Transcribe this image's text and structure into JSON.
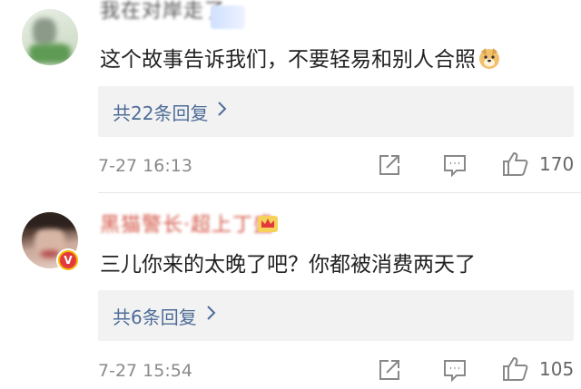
{
  "comments": [
    {
      "username": "我在对岸走了",
      "text": "这个故事告诉我们，不要轻易和别人合照",
      "emoji": "doge-icon",
      "reply_label": "共22条回复",
      "time": "7-27 16:13",
      "likes": "170"
    },
    {
      "username": "黑猫警长·超上丁盛",
      "text": "三儿你来的太晚了吧？你都被消费两天了",
      "verified_badge": "V",
      "reply_label": "共6条回复",
      "time": "7-27 15:54",
      "likes": "105"
    }
  ],
  "colors": {
    "reply_link": "#4d6c98",
    "reply_bg": "#f2f2f2",
    "meta_text": "#8a8a8a",
    "username_red": "#d55a4a"
  }
}
